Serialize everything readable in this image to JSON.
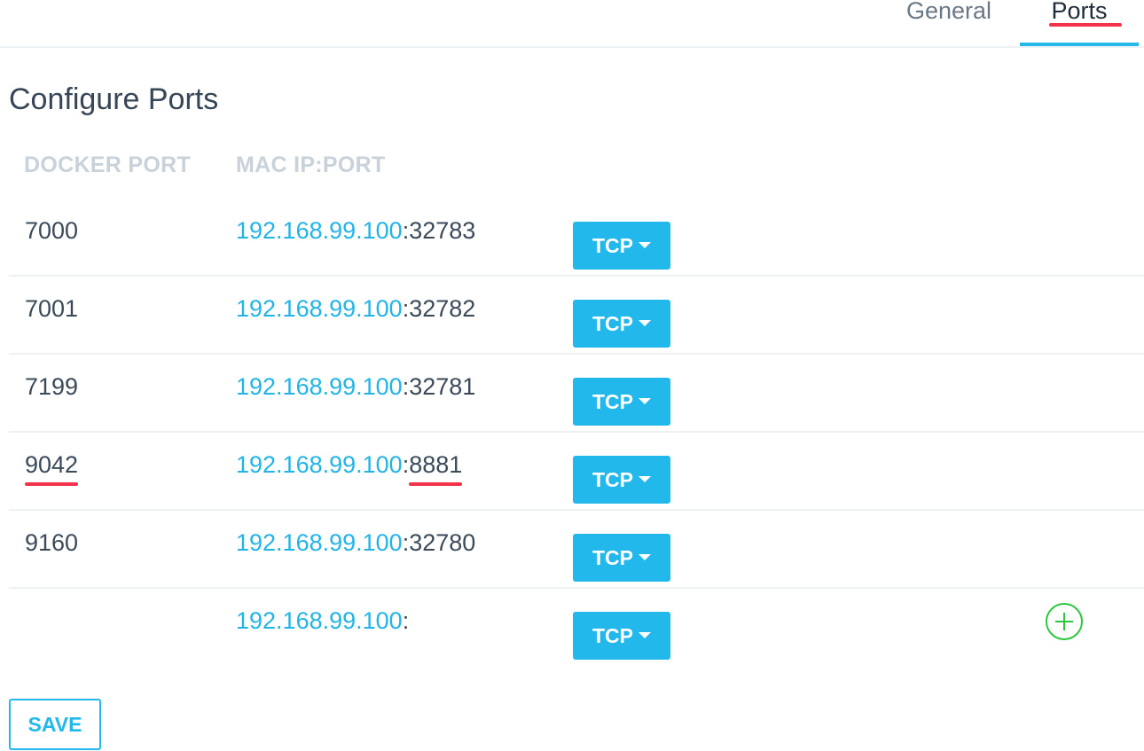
{
  "tabs": [
    {
      "label": "General",
      "active": false
    },
    {
      "label": "Ports",
      "active": true
    }
  ],
  "page_title": "Configure Ports",
  "table": {
    "headers": {
      "docker_port": "DOCKER PORT",
      "mac_ip_port": "MAC IP:PORT"
    },
    "rows": [
      {
        "docker_port": "7000",
        "ip": "192.168.99.100",
        "sep": ":",
        "port": "32783",
        "protocol": "TCP"
      },
      {
        "docker_port": "7001",
        "ip": "192.168.99.100",
        "sep": ":",
        "port": "32782",
        "protocol": "TCP"
      },
      {
        "docker_port": "7199",
        "ip": "192.168.99.100",
        "sep": ":",
        "port": "32781",
        "protocol": "TCP"
      },
      {
        "docker_port": "9042",
        "ip": "192.168.99.100",
        "sep": ":",
        "port": "8881",
        "protocol": "TCP"
      },
      {
        "docker_port": "9160",
        "ip": "192.168.99.100",
        "sep": ":",
        "port": "32780",
        "protocol": "TCP"
      },
      {
        "docker_port": "",
        "ip": "192.168.99.100",
        "sep": ":",
        "port": "",
        "protocol": "TCP"
      }
    ]
  },
  "save_label": "SAVE",
  "icons": {
    "add": "plus-circle-icon",
    "caret": "caret-down-icon"
  },
  "colors": {
    "accent": "#22b8eb",
    "add": "#2dc73f",
    "highlight": "#f2334a"
  }
}
